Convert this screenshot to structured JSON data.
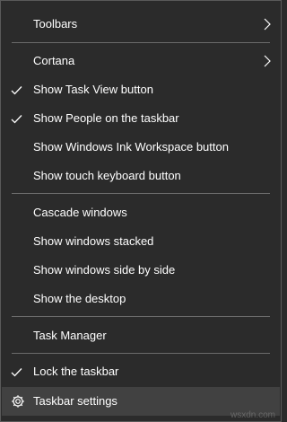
{
  "menu": {
    "items": [
      {
        "label": "Toolbars",
        "checked": false,
        "submenu": true
      },
      {
        "label": "Cortana",
        "checked": false,
        "submenu": true
      },
      {
        "label": "Show Task View button",
        "checked": true,
        "submenu": false
      },
      {
        "label": "Show People on the taskbar",
        "checked": true,
        "submenu": false
      },
      {
        "label": "Show Windows Ink Workspace button",
        "checked": false,
        "submenu": false
      },
      {
        "label": "Show touch keyboard button",
        "checked": false,
        "submenu": false
      },
      {
        "label": "Cascade windows",
        "checked": false,
        "submenu": false
      },
      {
        "label": "Show windows stacked",
        "checked": false,
        "submenu": false
      },
      {
        "label": "Show windows side by side",
        "checked": false,
        "submenu": false
      },
      {
        "label": "Show the desktop",
        "checked": false,
        "submenu": false
      },
      {
        "label": "Task Manager",
        "checked": false,
        "submenu": false
      },
      {
        "label": "Lock the taskbar",
        "checked": true,
        "submenu": false
      },
      {
        "label": "Taskbar settings",
        "icon": "gear-icon",
        "hovered": true
      }
    ]
  },
  "watermark": "wsxdn.com",
  "colors": {
    "background": "#2b2b2b",
    "text": "#ffffff",
    "separator": "#6b6b6b",
    "hover": "#414141"
  }
}
